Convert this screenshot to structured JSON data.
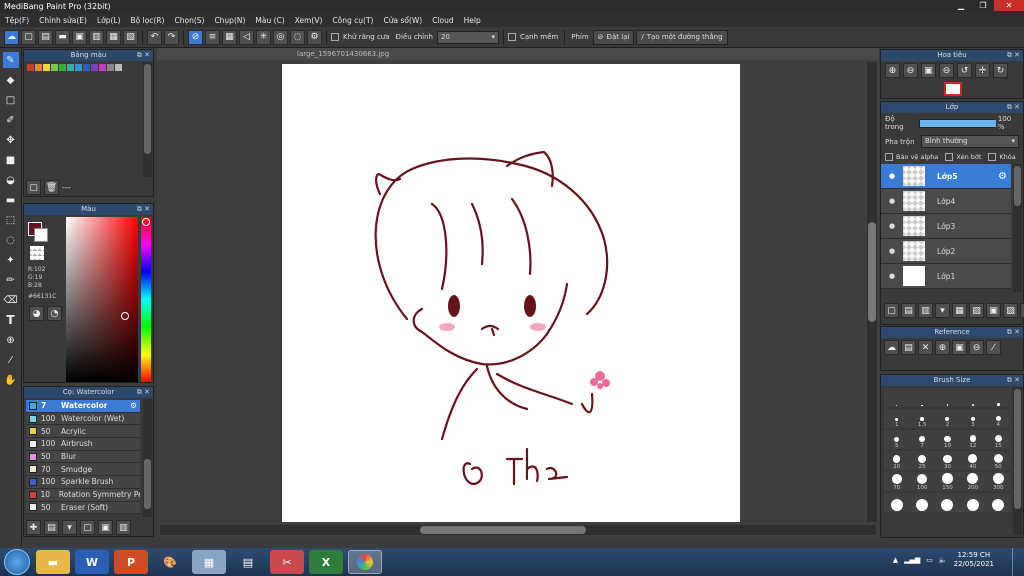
{
  "window": {
    "title": "MediBang Paint Pro (32bit)"
  },
  "menu": [
    "Tệp(F)",
    "Chỉnh sửa(E)",
    "Lớp(L)",
    "Bộ lọc(R)",
    "Chọn(S)",
    "Chụp(N)",
    "Màu (C)",
    "Xem(V)",
    "Công cụ(T)",
    "Cửa sổ(W)",
    "Cloud",
    "Help"
  ],
  "toolbar": {
    "antialias_label": "Khử răng cưa",
    "adjust_label": "Điều chỉnh",
    "adjust_value": "20",
    "edge_label": "Cạnh mềm",
    "key_label": "Phím",
    "reset_label": "Đặt lại",
    "make_line_label": "Tạo một đường thẳng"
  },
  "colorbar_panel": {
    "title": "Bảng màu",
    "footer_text": "---",
    "swatches": [
      "#e0312a",
      "#e58a2b",
      "#eed83a",
      "#83c740",
      "#2fae4a",
      "#2db3a0",
      "#2d9ad8",
      "#3356c9",
      "#7a3fc9",
      "#c23fb2",
      "#888888",
      "#bbbbbb"
    ]
  },
  "color_panel": {
    "title": "Màu",
    "r": "R:102",
    "g": "G:19",
    "b": "B:28",
    "hex": "#66131C"
  },
  "brush_panel": {
    "title": "Cọ: Watercolor",
    "items": [
      {
        "size": "7",
        "name": "Watercolor",
        "color": "#4aa3e8"
      },
      {
        "size": "100",
        "name": "Watercolor (Wet)",
        "color": "#6fd6e8"
      },
      {
        "size": "50",
        "name": "Acrylic",
        "color": "#e8d640"
      },
      {
        "size": "100",
        "name": "Airbrush",
        "color": "#f0f0f0"
      },
      {
        "size": "50",
        "name": "Blur",
        "color": "#e48fe0"
      },
      {
        "size": "70",
        "name": "Smudge",
        "color": "#f5e6c8"
      },
      {
        "size": "100",
        "name": "Sparkle Brush",
        "color": "#3a5fd6"
      },
      {
        "size": "10",
        "name": "Rotation Symmetry Pen",
        "color": "#d63a3a"
      },
      {
        "size": "50",
        "name": "Eraser (Soft)",
        "color": "#f0f0f0"
      }
    ]
  },
  "document": {
    "tab_title": "large_1596701430663.jpg"
  },
  "navigator": {
    "title": "Hoa tiêu"
  },
  "layer_panel": {
    "title": "Lớp",
    "opacity_label": "Độ trong",
    "opacity_value": "100 %",
    "opacity_fraction": 1.0,
    "blend_label": "Pha trộn",
    "blend_value": "Bình thường",
    "protect_alpha": "Bảo vệ alpha",
    "clipping": "Xén bớt",
    "lock": "Khóa",
    "layers": [
      "Lớp5",
      "Lớp4",
      "Lớp3",
      "Lớp2",
      "Lớp1"
    ]
  },
  "reference_panel": {
    "title": "Reference"
  },
  "brush_size_panel": {
    "title": "Brush Size",
    "sizes": [
      "",
      "",
      "",
      "",
      "",
      "1",
      "1.5",
      "2",
      "3",
      "4",
      "5",
      "7",
      "10",
      "12",
      "15",
      "20",
      "25",
      "30",
      "40",
      "50",
      "70",
      "100",
      "150",
      "200",
      "300",
      "",
      "",
      "",
      "",
      ""
    ]
  },
  "taskbar": {
    "time": "12:59 CH",
    "date": "22/05/2021",
    "apps": [
      "folder-icon",
      "word-icon",
      "powerpoint-icon",
      "paint-icon",
      "calculator-icon",
      "network-icon",
      "snipping-icon",
      "excel-icon",
      "medibang-icon"
    ]
  }
}
